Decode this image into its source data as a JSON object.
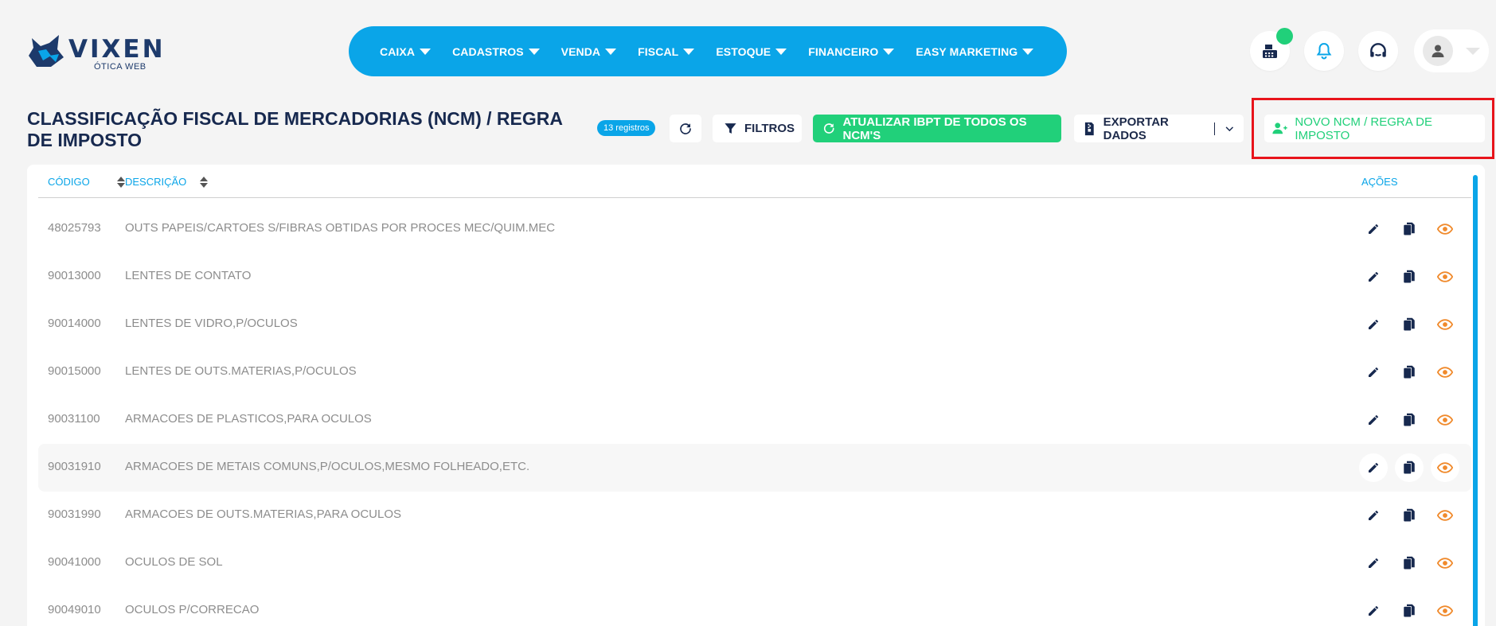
{
  "logo": {
    "brand": "VIXEN",
    "sub": "ÓTICA WEB"
  },
  "nav": [
    {
      "label": "CAIXA"
    },
    {
      "label": "CADASTROS"
    },
    {
      "label": "VENDA"
    },
    {
      "label": "FISCAL"
    },
    {
      "label": "ESTOQUE"
    },
    {
      "label": "FINANCEIRO"
    },
    {
      "label": "EASY MARKETING"
    }
  ],
  "header_icons": [
    "cash-register-icon",
    "bell-icon",
    "headset-icon",
    "user-icon"
  ],
  "page": {
    "title": "CLASSIFICAÇÃO FISCAL DE MERCADORIAS (NCM) / REGRA DE IMPOSTO",
    "count": "13 registros"
  },
  "toolbar": {
    "filters": "FILTROS",
    "update_ibpt": "ATUALIZAR IBPT DE TODOS OS NCM'S",
    "export": "EXPORTAR DADOS",
    "new": "NOVO NCM / REGRA DE IMPOSTO"
  },
  "table": {
    "headers": {
      "code": "CÓDIGO",
      "description": "DESCRIÇÃO",
      "actions": "AÇÕES"
    },
    "rows": [
      {
        "code": "48025793",
        "description": "OUTS PAPEIS/CARTOES S/FIBRAS OBTIDAS POR PROCES MEC/QUIM.MEC"
      },
      {
        "code": "90013000",
        "description": "LENTES DE CONTATO"
      },
      {
        "code": "90014000",
        "description": "LENTES DE VIDRO,P/OCULOS"
      },
      {
        "code": "90015000",
        "description": "LENTES DE OUTS.MATERIAS,P/OCULOS"
      },
      {
        "code": "90031100",
        "description": "ARMACOES DE PLASTICOS,PARA OCULOS"
      },
      {
        "code": "90031910",
        "description": "ARMACOES DE METAIS COMUNS,P/OCULOS,MESMO FOLHEADO,ETC."
      },
      {
        "code": "90031990",
        "description": "ARMACOES DE OUTS.MATERIAS,PARA OCULOS"
      },
      {
        "code": "90041000",
        "description": "OCULOS DE SOL"
      },
      {
        "code": "90049010",
        "description": "OCULOS P/CORRECAO"
      }
    ]
  },
  "colors": {
    "primary": "#0aa5e8",
    "success": "#21d07a",
    "navy": "#17294f",
    "orange": "#f08a2c",
    "highlight": "#e8141b"
  }
}
